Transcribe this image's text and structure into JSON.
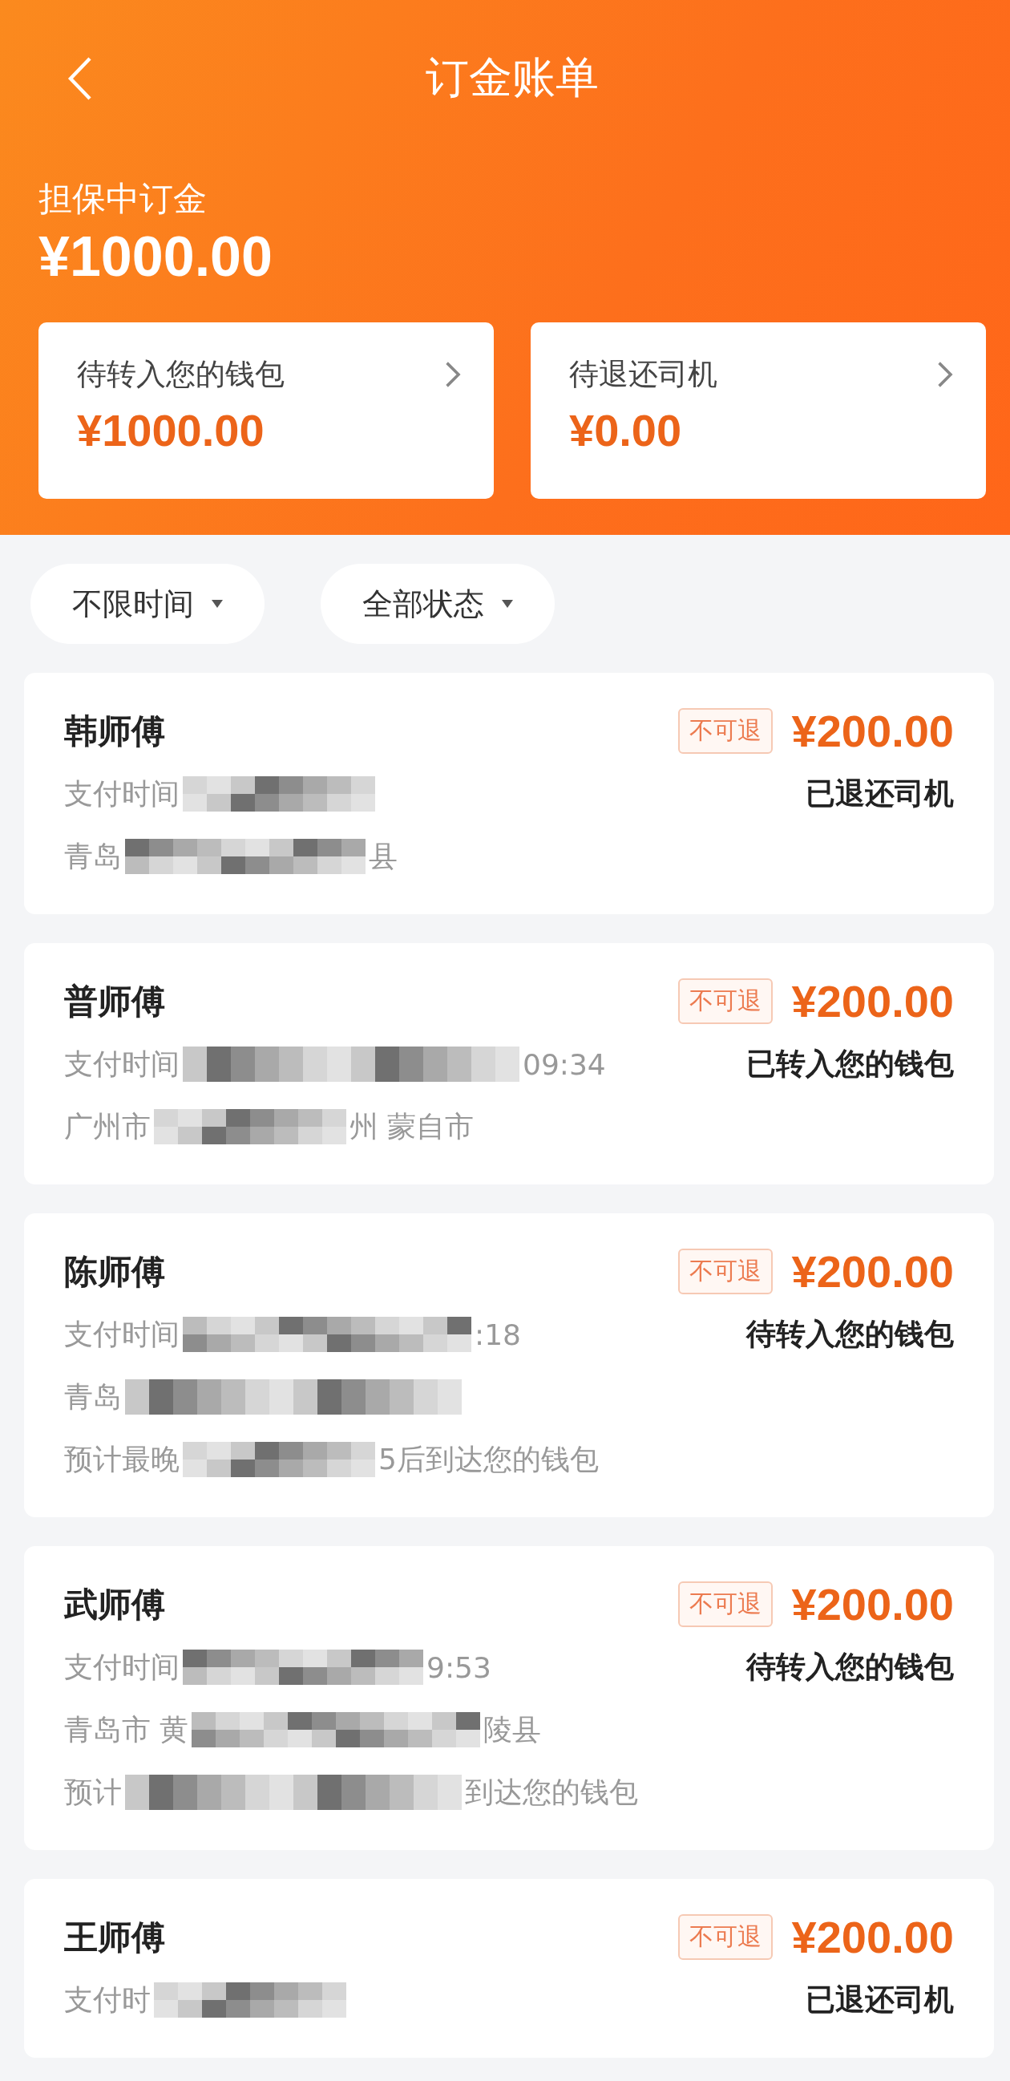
{
  "header": {
    "title": "订金账单",
    "escrow_label": "担保中订金",
    "escrow_amount": "¥1000.00"
  },
  "summary_cards": [
    {
      "label": "待转入您的钱包",
      "amount": "¥1000.00"
    },
    {
      "label": "待退还司机",
      "amount": "¥0.00"
    }
  ],
  "filters": [
    {
      "label": "不限时间"
    },
    {
      "label": "全部状态"
    }
  ],
  "orders": [
    {
      "name": "韩师傅",
      "badge": "不可退",
      "amount": "¥200.00",
      "status": "已退还司机",
      "lines": [
        {
          "prefix": "支付时间"
        },
        {
          "prefix": "青岛",
          "suffix": "县"
        }
      ]
    },
    {
      "name": "普师傅",
      "badge": "不可退",
      "amount": "¥200.00",
      "status": "已转入您的钱包",
      "lines": [
        {
          "prefix": "支付时间",
          "suffix": "09:34"
        },
        {
          "prefix": "广州市",
          "suffix": "州 蒙自市"
        }
      ]
    },
    {
      "name": "陈师傅",
      "badge": "不可退",
      "amount": "¥200.00",
      "status": "待转入您的钱包",
      "lines": [
        {
          "prefix": "支付时间",
          "suffix": ":18"
        },
        {
          "prefix": "青岛"
        },
        {
          "prefix": "预计最晚",
          "suffix": "5后到达您的钱包"
        }
      ]
    },
    {
      "name": "武师傅",
      "badge": "不可退",
      "amount": "¥200.00",
      "status": "待转入您的钱包",
      "lines": [
        {
          "prefix": "支付时间",
          "suffix": "9:53"
        },
        {
          "prefix": "青岛市 黄",
          "suffix": "陵县"
        },
        {
          "prefix": "预计",
          "suffix": "到达您的钱包"
        }
      ]
    },
    {
      "name": "王师傅",
      "badge": "不可退",
      "amount": "¥200.00",
      "status": "已退还司机",
      "lines": [
        {
          "prefix": "支付时"
        }
      ]
    }
  ]
}
